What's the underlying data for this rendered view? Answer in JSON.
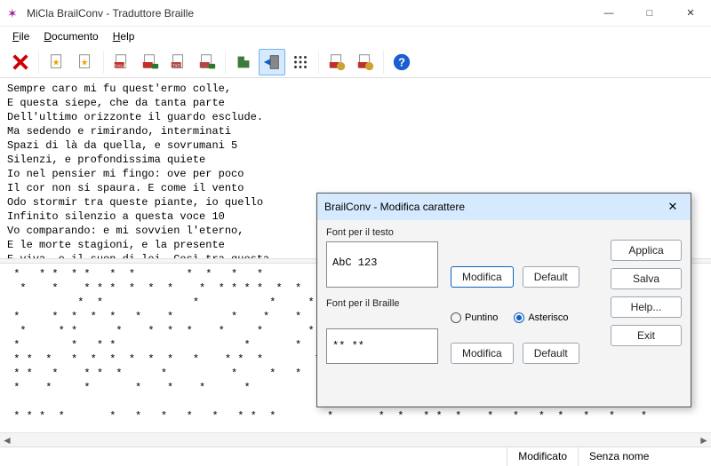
{
  "window": {
    "title": "MiCla BrailConv - Traduttore Braille",
    "min": "—",
    "max": "□",
    "close": "✕"
  },
  "menu": {
    "file": "File",
    "documento": "Documento",
    "help": "Help"
  },
  "toolbar": {
    "delete": "delete",
    "new1": "new-doc",
    "new2": "new-doc-2",
    "braille1": "braille-a",
    "braille2": "braille-b",
    "txt1": "txt-a",
    "txt2": "txt-b",
    "shape": "shape",
    "arrow": "arrow-block",
    "dots": "dots-matrix",
    "doc1": "recent-a",
    "doc2": "recent-b",
    "help": "help"
  },
  "editor_text": "Sempre caro mi fu quest'ermo colle,\nE questa siepe, che da tanta parte\nDell'ultimo orizzonte il guardo esclude.\nMa sedendo e rimirando, interminati\nSpazi di là da quella, e sovrumani 5\nSilenzi, e profondissima quiete\nIo nel pensier mi fingo: ove per poco\nIl cor non si spaura. E come il vento\nOdo stormir tra queste piante, io quello\nInfinito silenzio a questa voce 10\nVo comparando: e mi sovvien l'eterno,\nE le morte stagioni, e la presente\nE viva, e il suon di lei. Così tra questa",
  "braille_text": " *   * *  * *   *  *        *  *   *   *         * *  *        *  *        *  *  * * \n  *    *    * * *  *  *  *    *  * * * *  *  *         *  *  *        *        *   * \n           *  *              *           *     *  *     *        *              *     *  *   \n *     *  *  *  *   *    *         *    *    *   *   *         *  *    *       * *  * \n  *     * *      *    *  *  *    *     *       *  * *    *         *    *  *    *    \n *        *   * *                    *       *                          *               *   \n * *  *   *  *  *  *  *  *   *    * *  *        *      *  *   *  *    *   *   *       *  *  *     \n * *   *    * *  *      *          *     *   *         *  *     *      *   *        *    *   \n *    *     *       *    *    *      *                  *  *    *   *  *               *        \n\n * * *  *       *   *   *   *   *   * *  *        *       *  *   * *  *    *   *   *  *   *   *    *",
  "dialog": {
    "title": "BrailConv - Modifica carattere",
    "close": "✕",
    "font_text_label": "Font per il testo",
    "font_text_sample": "AbC 123",
    "font_braille_label": "Font per il Braille",
    "font_braille_sample": "** **",
    "modifica": "Modifica",
    "default": "Default",
    "puntino": "Puntino",
    "asterisco": "Asterisco",
    "applica": "Applica",
    "salva": "Salva",
    "help": "Help...",
    "exit": "Exit"
  },
  "status": {
    "modified": "Modificato",
    "filename": "Senza nome"
  }
}
